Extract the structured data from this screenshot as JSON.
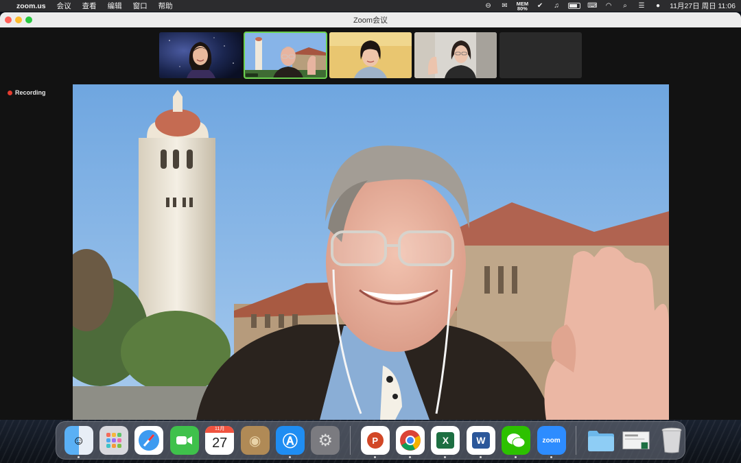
{
  "menubar": {
    "app_name": "zoom.us",
    "items": [
      "会议",
      "查看",
      "编辑",
      "窗口",
      "帮助"
    ],
    "mem_label": "MEM",
    "mem_value": "80%",
    "clock": "11月27日 周日  11:06"
  },
  "window": {
    "title": "Zoom会议"
  },
  "meeting": {
    "recording_label": "Recording",
    "participants": [
      {
        "kind": "woman-galaxy-background"
      },
      {
        "kind": "man-tower-background",
        "active": true
      },
      {
        "kind": "woman-yellow-background"
      },
      {
        "kind": "woman-room-background"
      },
      {
        "kind": "empty"
      }
    ]
  },
  "dock": {
    "calendar_month": "11月",
    "calendar_day": "27",
    "zoom_label": "zoom",
    "apps": [
      "finder",
      "launchpad",
      "safari",
      "facetime",
      "calendar",
      "contacts",
      "app-store",
      "system-preferences",
      "powerpoint",
      "chrome",
      "excel",
      "word",
      "wechat",
      "zoom",
      "downloads-folder",
      "document-stack",
      "trash"
    ]
  },
  "colors": {
    "menubar_bg": "#2c2c2e",
    "active_speaker_border": "#6ad14f",
    "recording_dot": "#e43c2f",
    "zoom_blue": "#2d8cff"
  }
}
